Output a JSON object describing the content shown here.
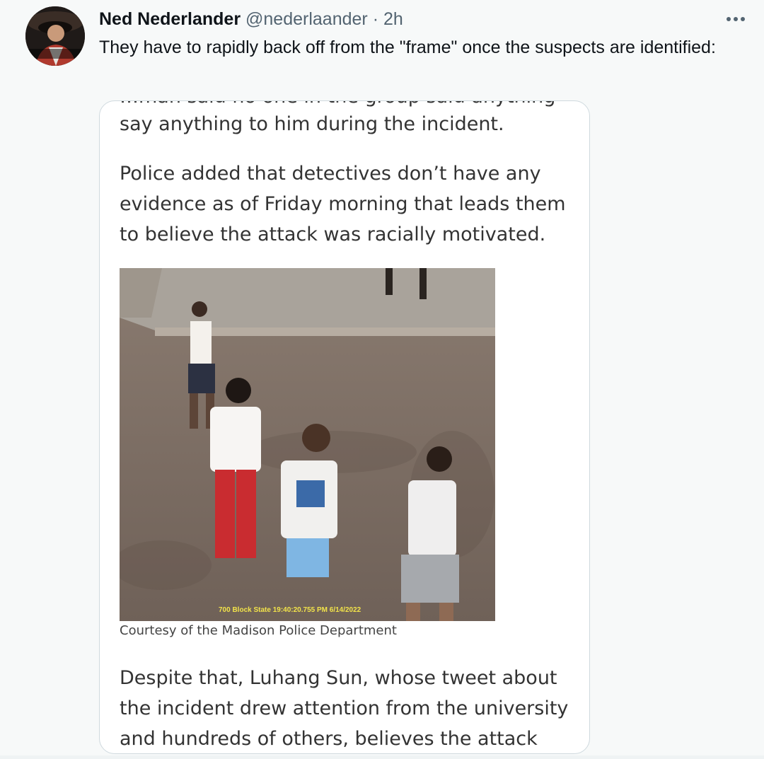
{
  "tweet": {
    "display_name": "Ned Nederlander",
    "handle": "@nederlaander",
    "separator": "·",
    "time": "2h",
    "more_icon": "more-horizontal-icon",
    "text": "They have to rapidly back off from the \"frame\" once the suspects are identified:"
  },
  "article": {
    "cut_line": "…man said no one in the group said anything",
    "paragraph_1": "say anything to him during the incident.",
    "paragraph_2": "Police added that detectives don’t have any evidence as of Friday morning that leads them to believe the attack was racially motivated.",
    "photo_overlay": "700 Block State 19:40:20.755 PM 6/14/2022",
    "caption": "Courtesy of the Madison Police Department",
    "paragraph_3": "Despite that, Luhang Sun, whose tweet about the incident drew attention from the university and hundreds of others, believes the attack was"
  },
  "colors": {
    "background": "#f7f9f9",
    "card_border": "#cfd9de",
    "secondary_text": "#536471",
    "overlay_text": "#f2e34a"
  }
}
